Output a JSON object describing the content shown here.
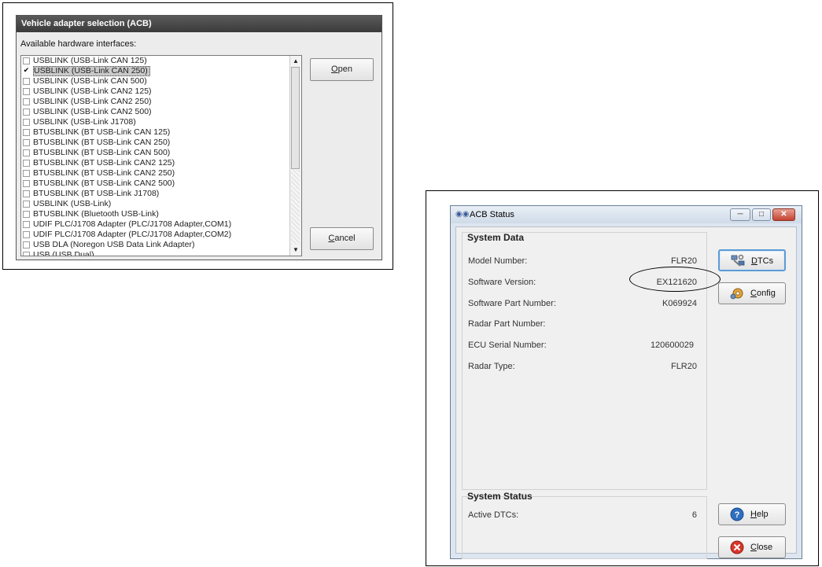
{
  "adapter_dialog": {
    "title": "Vehicle adapter selection (ACB)",
    "list_label": "Available hardware interfaces:",
    "items": [
      {
        "label": "USBLINK (USB-Link CAN 125)",
        "checked": false,
        "selected": false
      },
      {
        "label": "USBLINK (USB-Link CAN 250)",
        "checked": true,
        "selected": true
      },
      {
        "label": "USBLINK (USB-Link CAN 500)",
        "checked": false,
        "selected": false
      },
      {
        "label": "USBLINK (USB-Link CAN2 125)",
        "checked": false,
        "selected": false
      },
      {
        "label": "USBLINK (USB-Link CAN2 250)",
        "checked": false,
        "selected": false
      },
      {
        "label": "USBLINK (USB-Link CAN2 500)",
        "checked": false,
        "selected": false
      },
      {
        "label": "USBLINK (USB-Link J1708)",
        "checked": false,
        "selected": false
      },
      {
        "label": "BTUSBLINK (BT USB-Link CAN 125)",
        "checked": false,
        "selected": false
      },
      {
        "label": "BTUSBLINK (BT USB-Link CAN 250)",
        "checked": false,
        "selected": false
      },
      {
        "label": "BTUSBLINK (BT USB-Link CAN 500)",
        "checked": false,
        "selected": false
      },
      {
        "label": "BTUSBLINK (BT USB-Link CAN2 125)",
        "checked": false,
        "selected": false
      },
      {
        "label": "BTUSBLINK (BT USB-Link CAN2 250)",
        "checked": false,
        "selected": false
      },
      {
        "label": "BTUSBLINK (BT USB-Link CAN2 500)",
        "checked": false,
        "selected": false
      },
      {
        "label": "BTUSBLINK (BT USB-Link J1708)",
        "checked": false,
        "selected": false
      },
      {
        "label": "USBLINK (USB-Link)",
        "checked": false,
        "selected": false
      },
      {
        "label": "BTUSBLINK (Bluetooth USB-Link)",
        "checked": false,
        "selected": false
      },
      {
        "label": "UDIF PLC/J1708 Adapter (PLC/J1708 Adapter,COM1)",
        "checked": false,
        "selected": false
      },
      {
        "label": "UDIF PLC/J1708 Adapter (PLC/J1708 Adapter,COM2)",
        "checked": false,
        "selected": false
      },
      {
        "label": "USB DLA (Noregon USB Data Link Adapter)",
        "checked": false,
        "selected": false
      },
      {
        "label": "USB (USB Dual)",
        "checked": false,
        "selected": false
      }
    ],
    "open_button": {
      "accel": "O",
      "rest": "pen"
    },
    "cancel_button": {
      "accel": "C",
      "rest": "ancel"
    }
  },
  "acb_status": {
    "title": "ACB Status",
    "app_icon": "binoculars-icon",
    "system_data": {
      "heading": "System Data",
      "rows": [
        {
          "label": "Model Number:",
          "value": "FLR20"
        },
        {
          "label": "Software Version:",
          "value": "EX121620"
        },
        {
          "label": "Software Part Number:",
          "value": "K069924"
        },
        {
          "label": "Radar Part Number:",
          "value": ""
        },
        {
          "label": "ECU Serial Number:",
          "value": "120600029"
        },
        {
          "label": "Radar Type:",
          "value": "FLR20"
        }
      ]
    },
    "system_status": {
      "heading": "System Status",
      "active_dtcs_label": "Active DTCs:",
      "active_dtcs_value": "6"
    },
    "buttons": {
      "dtcs": {
        "accel": "D",
        "rest": "TCs",
        "icon": "wrench-network-icon"
      },
      "config": {
        "accel": "C",
        "rest": "onfig",
        "icon": "gear-icon"
      },
      "help": {
        "accel": "H",
        "rest": "elp",
        "icon": "help-icon"
      },
      "close": {
        "accel": "C",
        "rest": "lose",
        "icon": "close-circle-icon"
      }
    },
    "caption_buttons": {
      "minimize": "minimize-icon",
      "maximize": "maximize-icon",
      "close": "close-icon"
    },
    "highlight_color": "#5b9bd5"
  }
}
